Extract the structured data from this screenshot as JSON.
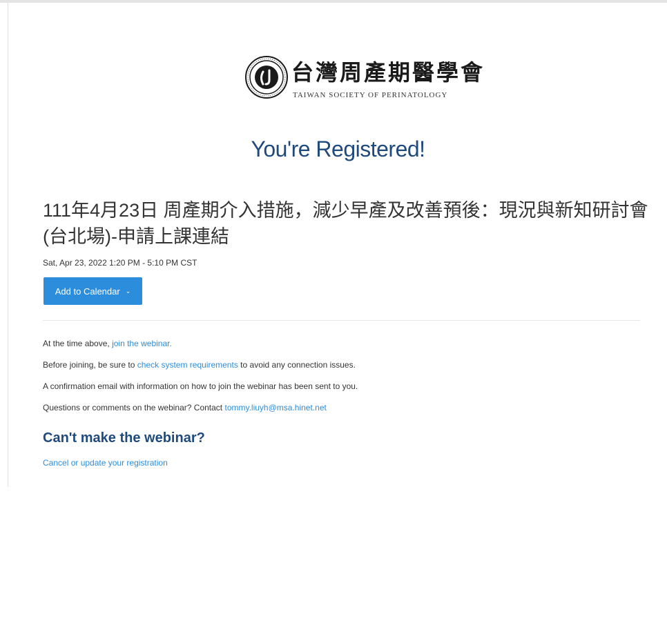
{
  "logo": {
    "name_cn": "台灣周產期醫學會",
    "name_en": "TAIWAN  SOCIETY  OF  PERINATOLOGY",
    "seal_icon": "society-seal-icon"
  },
  "heading": "You're Registered!",
  "webinar": {
    "title": "111年4月23日 周產期介入措施，減少早產及改善預後：現況與新知研討會(台北場)-申請上課連結",
    "date": "Sat, Apr 23, 2022 1:20 PM - 5:10 PM CST"
  },
  "calendar_button": {
    "label": "Add to Calendar",
    "icon": "chevron-down-icon"
  },
  "info": {
    "line1_prefix": "At the time above,",
    "line1_link": "join the webinar.",
    "line2_prefix": "Before joining, be sure to",
    "line2_link": "check system requirements",
    "line2_suffix": "to avoid any connection issues.",
    "line3": "A confirmation email with information on how to join the webinar has been sent to you.",
    "line4_prefix": "Questions or comments on the webinar? Contact",
    "line4_link": "tommy.liuyh@msa.hinet.net"
  },
  "cant_make": {
    "title": "Can't make the webinar?",
    "link": "Cancel or update your registration"
  },
  "colors": {
    "accent": "#2d8ddd",
    "heading": "#1e4a7d"
  }
}
